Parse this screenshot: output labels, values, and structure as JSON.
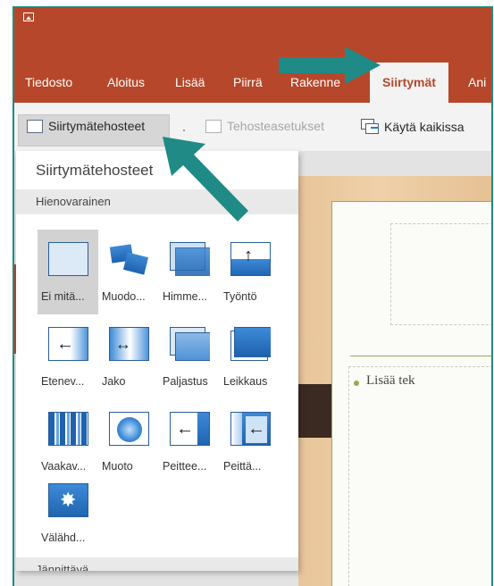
{
  "tabs": {
    "file": "Tiedosto",
    "home": "Aloitus",
    "insert": "Lisää",
    "draw": "Piirrä",
    "design": "Rakenne",
    "transitions": "Siirtymät",
    "animations": "Ani"
  },
  "toolbar": {
    "transition_effects": "Siirtymätehosteet",
    "effect_options": "Tehosteasetukset",
    "apply_all": "Käytä kaikissa"
  },
  "gallery": {
    "title": "Siirtymätehosteet",
    "section_subtle": "Hienovarainen",
    "section_exciting": "Jännittävä",
    "items": [
      {
        "label": "Ei mitä..."
      },
      {
        "label": "Muodo..."
      },
      {
        "label": "Himme..."
      },
      {
        "label": "Työntö"
      },
      {
        "label": "Etenev..."
      },
      {
        "label": "Jako"
      },
      {
        "label": "Paljastus"
      },
      {
        "label": "Leikkaus"
      },
      {
        "label": "Vaakav..."
      },
      {
        "label": "Muoto"
      },
      {
        "label": "Peittee..."
      },
      {
        "label": "Peittä..."
      },
      {
        "label": "Välähd..."
      }
    ]
  },
  "slide": {
    "bullet_text": "Lisää tek"
  },
  "colors": {
    "ribbon": "#b7472a",
    "annotation_arrow": "#1f8a86"
  }
}
